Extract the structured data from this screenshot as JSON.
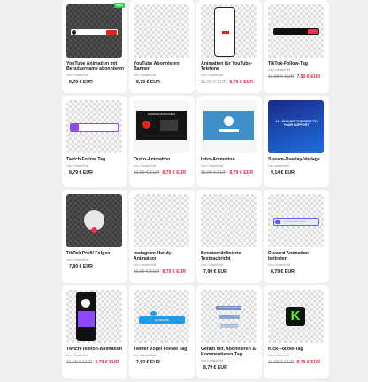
{
  "colors": {
    "sale": "#e3284b",
    "badge": "#2fd14e",
    "twitch": "#9146ff"
  },
  "products": [
    {
      "title": "YouTube Animation mit Benutzername abonnieren",
      "seller": "Von CreatorSell",
      "old_price": "",
      "price": "8,79 € EUR",
      "badge": "NEU"
    },
    {
      "title": "YouTube Abonnieren Banner",
      "seller": "Von CreatorSell",
      "old_price": "",
      "price": "8,79 € EUR"
    },
    {
      "title": "Animation für YouTube-Telefone",
      "seller": "Von CreatorSell",
      "old_price": "11,99 € EUR",
      "price": "8,79 € EUR"
    },
    {
      "title": "TikTok-Follow-Tag",
      "seller": "Von CreatorSell",
      "old_price": "11,99 € EUR",
      "price": "7,90 € EUR"
    },
    {
      "title": "Twitch Follow Tag",
      "seller": "Von CreatorSell",
      "old_price": "",
      "price": "8,79 € EUR"
    },
    {
      "title": "Outro-Animation",
      "seller": "Von CreatorSell",
      "old_price": "11,99 € EUR",
      "price": "8,79 € EUR"
    },
    {
      "title": "Intro-Animation",
      "seller": "Von CreatorSell",
      "old_price": "11,99 € EUR",
      "price": "8,79 € EUR"
    },
    {
      "title": "Stream-Overlay-Vorlage",
      "seller": "Von creatorsell",
      "old_price": "",
      "price": "9,14 € EUR"
    },
    {
      "title": "TikTok Profil Folgen",
      "seller": "Von CreatorSell",
      "old_price": "",
      "price": "7,90 € EUR"
    },
    {
      "title": "Instagram-Handy-Animation",
      "seller": "Von CreatorSell",
      "old_price": "11,99 € EUR",
      "price": "8,79 € EUR"
    },
    {
      "title": "Benutzerdefinierte Textnachricht",
      "seller": "Von CreatorSell",
      "old_price": "",
      "price": "7,90 € EUR"
    },
    {
      "title": "Discord Animation beitreten",
      "seller": "Von CreatorSell",
      "old_price": "",
      "price": "8,79 € EUR"
    },
    {
      "title": "Twitch-Telefon-Animation",
      "seller": "Von CreatorSell",
      "old_price": "11,99 € EUR",
      "price": "8,79 € EUR"
    },
    {
      "title": "Twitter Vögel Follow Tag",
      "seller": "Von CreatorSell",
      "old_price": "",
      "price": "7,90 € EUR"
    },
    {
      "title": "Gefällt mir, Abonnieren & Kommentieren-Tag",
      "seller": "Von CreatorSell",
      "old_price": "",
      "price": "8,79 € EUR"
    },
    {
      "title": "Kick-Follow-Tag",
      "seller": "Von creatorsell",
      "old_price": "11,99 € EUR",
      "price": "8,79 € EUR"
    }
  ],
  "thumb_text": {
    "outro": "THANKS FOR WATCHING",
    "overlay": "#1 - CHANGE THE BEST TO YOUR SUPPORT",
    "discord": "JOIN MY DISCORD",
    "twitter": "@CREATOR",
    "like": "LIKE SHARE SUBSCRIBE",
    "kick": "K"
  }
}
